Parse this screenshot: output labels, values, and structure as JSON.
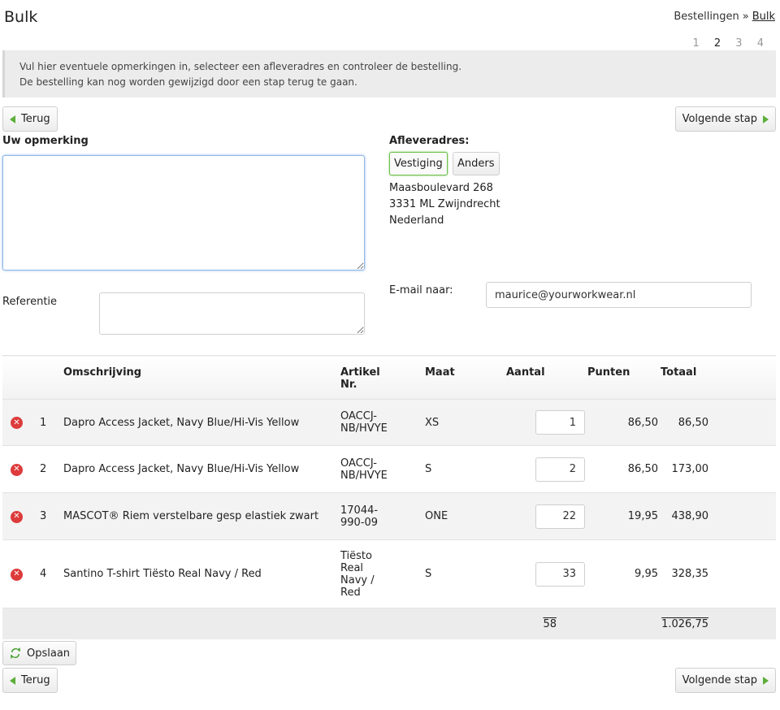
{
  "page": {
    "title": "Bulk",
    "breadcrumb": {
      "parent": "Bestellingen",
      "separator": "»",
      "current": "Bulk"
    },
    "steps": [
      "1",
      "2",
      "3",
      "4"
    ],
    "active_step": 2,
    "notice_line1": "Vul hier eventuele opmerkingen in, selecteer een afleveradres en controleer de bestelling.",
    "notice_line2": "De bestelling kan nog worden gewijzigd door een stap terug te gaan."
  },
  "nav": {
    "back_label": "Terug",
    "next_label": "Volgende stap",
    "save_label": "Opslaan"
  },
  "form": {
    "comment_label": "Uw opmerking",
    "comment_value": "",
    "reference_label": "Referentie",
    "reference_value": "",
    "delivery_label": "Afleveradres:",
    "delivery_options": [
      "Vestiging",
      "Anders"
    ],
    "delivery_selected": "Vestiging",
    "address": {
      "street": "Maasboulevard 268",
      "city": "3331 ML Zwijndrecht",
      "country": "Nederland"
    },
    "email_label": "E-mail naar:",
    "email_value": "maurice@yourworkwear.nl"
  },
  "table": {
    "headers": {
      "description": "Omschrijving",
      "article": "Artikel Nr.",
      "size": "Maat",
      "qty": "Aantal",
      "points": "Punten",
      "total": "Totaal"
    },
    "rows": [
      {
        "index": "1",
        "description": "Dapro Access Jacket, Navy Blue/Hi-Vis Yellow",
        "article": "OACCJ-NB/HVYE",
        "size": "XS",
        "qty": "1",
        "points": "86,50",
        "total": "86,50"
      },
      {
        "index": "2",
        "description": "Dapro Access Jacket, Navy Blue/Hi-Vis Yellow",
        "article": "OACCJ-NB/HVYE",
        "size": "S",
        "qty": "2",
        "points": "86,50",
        "total": "173,00"
      },
      {
        "index": "3",
        "description": "MASCOT® Riem verstelbare gesp elastiek zwart",
        "article": "17044-990-09",
        "size": "ONE",
        "qty": "22",
        "points": "19,95",
        "total": "438,90"
      },
      {
        "index": "4",
        "description": "Santino T-shirt Tiësto Real Navy / Red",
        "article": "Tiësto Real Navy / Red",
        "size": "S",
        "qty": "33",
        "points": "9,95",
        "total": "328,35"
      }
    ],
    "footer": {
      "qty_sum": "58",
      "total_sum": "1.026,75"
    }
  },
  "colors": {
    "accent_green": "#5cae3a",
    "delete_red": "#dd3b3b",
    "focus_blue": "#8fb6e6"
  },
  "icons": {
    "back": "arrow-left-icon",
    "next": "arrow-right-icon",
    "delete": "delete-circle-icon",
    "save": "refresh-icon"
  }
}
